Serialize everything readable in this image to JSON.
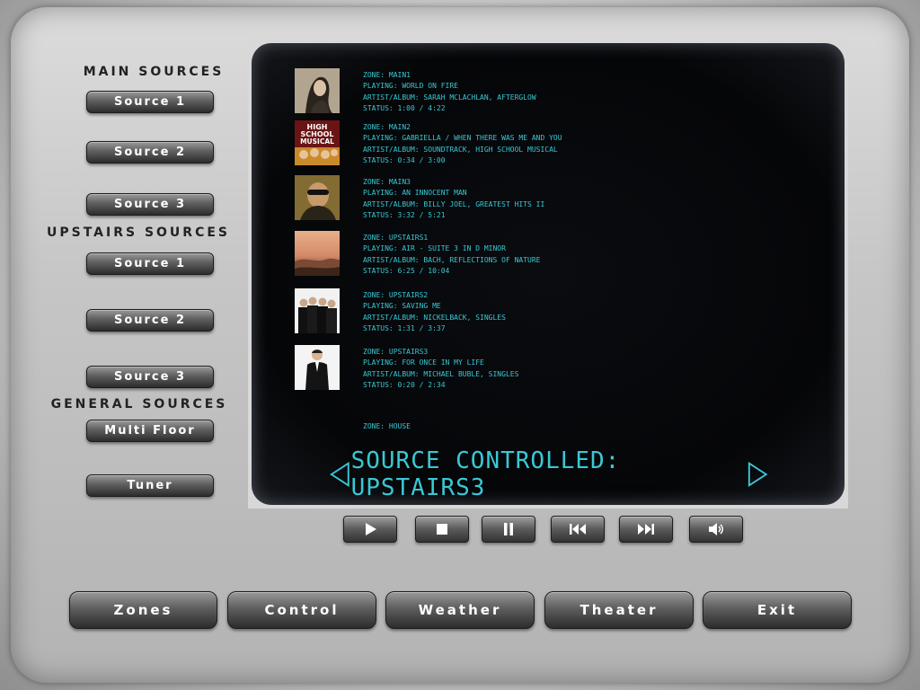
{
  "sections": {
    "main": {
      "title": "MAIN SOURCES",
      "buttons": [
        "Source 1",
        "Source 2",
        "Source 3"
      ]
    },
    "upstairs": {
      "title": "UPSTAIRS SOURCES",
      "buttons": [
        "Source 1",
        "Source 2",
        "Source 3"
      ]
    },
    "general": {
      "title": "GENERAL SOURCES",
      "buttons": [
        "Multi Floor",
        "Tuner"
      ]
    }
  },
  "zones": [
    {
      "zone": "ZONE: MAIN1",
      "playing": "PLAYING: WORLD ON FIRE",
      "artist": "ARTIST/ALBUM: SARAH MCLACHLAN, AFTERGLOW",
      "status": "STATUS: 1:00 / 4:22"
    },
    {
      "zone": "ZONE: MAIN2",
      "playing": "PLAYING: GABRIELLA / WHEN THERE WAS ME AND YOU",
      "artist": "ARTIST/ALBUM: SOUNDTRACK, HIGH SCHOOL MUSICAL",
      "status": "STATUS: 0:34 / 3:00"
    },
    {
      "zone": "ZONE: MAIN3",
      "playing": "PLAYING: AN INNOCENT MAN",
      "artist": "ARTIST/ALBUM: BILLY JOEL, GREATEST HITS II",
      "status": "STATUS: 3:32 / 5:21"
    },
    {
      "zone": "ZONE: UPSTAIRS1",
      "playing": "PLAYING: AIR - SUITE 3 IN D MINOR",
      "artist": "ARTIST/ALBUM: BACH, REFLECTIONS OF NATURE",
      "status": "STATUS: 6:25 / 10:04"
    },
    {
      "zone": "ZONE: UPSTAIRS2",
      "playing": "PLAYING: SAVING ME",
      "artist": "ARTIST/ALBUM: NICKELBACK, SINGLES",
      "status": "STATUS: 1:31 / 3:37"
    },
    {
      "zone": "ZONE: UPSTAIRS3",
      "playing": "PLAYING: FOR ONCE IN MY LIFE",
      "artist": "ARTIST/ALBUM: MICHAEL BUBLE, SINGLES",
      "status": "STATUS: 0:20 / 2:34"
    }
  ],
  "house_zone": "ZONE: HOUSE",
  "album_art_text": {
    "hsm_line1": "HIGH",
    "hsm_line2": "SCHOOL",
    "hsm_line3": "MUSICAL"
  },
  "source_controlled": "SOURCE CONTROLLED: UPSTAIRS3",
  "transport": {
    "play": "play-icon",
    "stop": "stop-icon",
    "pause": "pause-icon",
    "previous": "skip-back-icon",
    "next": "skip-forward-icon",
    "volume": "speaker-icon"
  },
  "nav": [
    "Zones",
    "Control",
    "Weather",
    "Theater",
    "Exit"
  ],
  "colors": {
    "screen_text": "#39c8d4",
    "screen_bg": "#050608",
    "button_top": "#9a9a9a",
    "button_bottom": "#2c2c2c"
  }
}
